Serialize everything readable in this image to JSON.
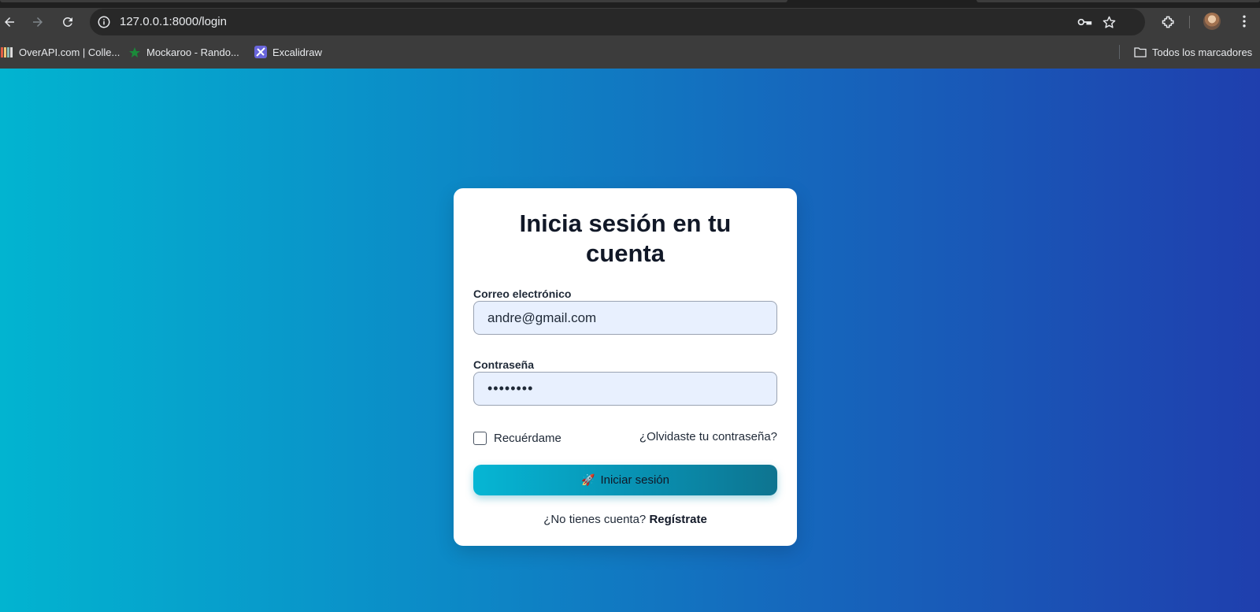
{
  "browser": {
    "url": "127.0.0.1:8000/login",
    "bookmarks": [
      {
        "label": "OverAPI.com | Colle...",
        "icon": "overapi-favicon"
      },
      {
        "label": "Mockaroo - Rando...",
        "icon": "mockaroo-favicon"
      },
      {
        "label": "Excalidraw",
        "icon": "excalidraw-favicon"
      }
    ],
    "all_bookmarks_label": "Todos los marcadores"
  },
  "login": {
    "title": "Inicia sesión en tu cuenta",
    "email_label": "Correo electrónico",
    "email_value": "andre@gmail.com",
    "password_label": "Contraseña",
    "password_value": "••••••••",
    "remember_label": "Recuérdame",
    "forgot_link": "¿Olvidaste tu contraseña?",
    "submit_icon": "🚀",
    "submit_label": "Iniciar sesión",
    "signup_prompt": "¿No tienes cuenta?",
    "signup_link": "Regístrate"
  },
  "colors": {
    "gradient_start": "#02b4d0",
    "gradient_end": "#1f3fae",
    "button_start": "#06b6d4",
    "button_end": "#0e7490"
  }
}
